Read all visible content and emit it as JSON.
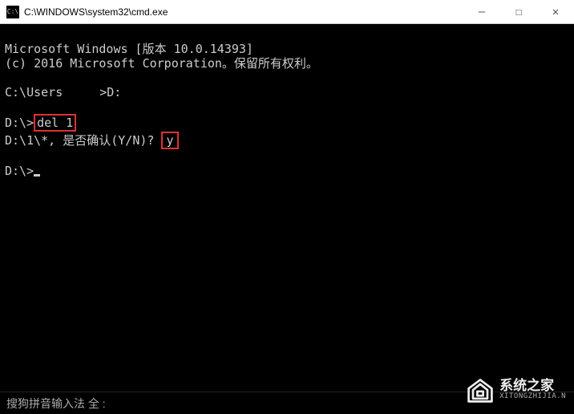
{
  "titlebar": {
    "icon_text": "C:\\",
    "title": "C:\\WINDOWS\\system32\\cmd.exe",
    "minimize": "—",
    "maximize": "☐",
    "close": "✕"
  },
  "terminal": {
    "line1": "Microsoft Windows [版本 10.0.14393]",
    "line2": "(c) 2016 Microsoft Corporation。保留所有权利。",
    "prompt_c_prefix": "C:\\Users",
    "prompt_c_suffix": ">D:",
    "prompt_d": "D:\\>",
    "cmd_del": "del 1",
    "confirm_line_prefix": "D:\\1\\*, 是否确认(Y/N)?",
    "confirm_input": "y",
    "prompt_d_final": "D:\\>"
  },
  "ime": {
    "text": "搜狗拼音输入法 全 :"
  },
  "watermark": {
    "main": "系统之家",
    "sub": "XITONGZHIJIA.N"
  }
}
